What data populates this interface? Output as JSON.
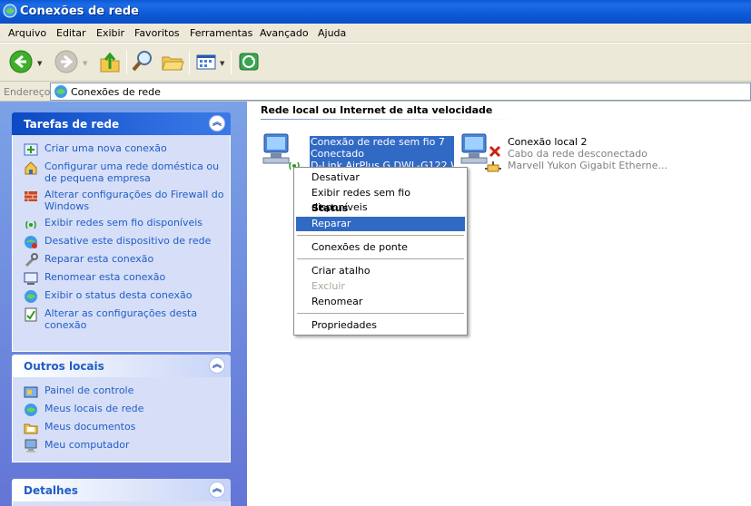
{
  "window": {
    "title": "Conexões de rede"
  },
  "menu": [
    "Arquivo",
    "Editar",
    "Exibir",
    "Favoritos",
    "Ferramentas",
    "Avançado",
    "Ajuda"
  ],
  "address": {
    "label": "Endereço",
    "value": "Conexões de rede"
  },
  "left": {
    "panels": [
      {
        "title": "Tarefas de rede",
        "items": [
          {
            "label": "Criar uma nova conexão",
            "icon": "new-connection-icon"
          },
          {
            "label": "Configurar uma rede doméstica ou de pequena empresa",
            "icon": "home-network-icon"
          },
          {
            "label": "Alterar configurações do Firewall do Windows",
            "icon": "firewall-icon"
          },
          {
            "label": "Exibir redes sem fio disponíveis",
            "icon": "wireless-icon"
          },
          {
            "label": "Desative este dispositivo de rede",
            "icon": "disable-device-icon"
          },
          {
            "label": "Reparar esta conexão",
            "icon": "repair-icon"
          },
          {
            "label": "Renomear esta conexão",
            "icon": "rename-icon"
          },
          {
            "label": "Exibir o status desta conexão",
            "icon": "status-icon"
          },
          {
            "label": "Alterar as configurações desta conexão",
            "icon": "settings-icon"
          }
        ]
      },
      {
        "title": "Outros locais",
        "items": [
          {
            "label": "Painel de controle",
            "icon": "control-panel-icon"
          },
          {
            "label": "Meus locais de rede",
            "icon": "network-places-icon"
          },
          {
            "label": "Meus documentos",
            "icon": "documents-icon"
          },
          {
            "label": "Meu computador",
            "icon": "computer-icon"
          }
        ]
      },
      {
        "title": "Detalhes",
        "items": []
      }
    ]
  },
  "main": {
    "group_title": "Rede local ou Internet de alta velocidade",
    "connections": [
      {
        "name": "Conexão de rede sem fio 7",
        "status": "Conectado",
        "device": "D-Link AirPlus G DWL-G122 Wi..."
      },
      {
        "name": "Conexão local 2",
        "status": "Cabo da rede desconectado",
        "device": "Marvell Yukon Gigabit Etherne..."
      }
    ]
  },
  "context_menu": {
    "items": [
      "Desativar",
      "Exibir redes sem fio disponíveis",
      "Status",
      "Reparar",
      "Conexões de ponte",
      "Criar atalho",
      "Excluir",
      "Renomear",
      "Propriedades"
    ]
  },
  "colors": {
    "titlebar": "#0a5ad6",
    "selection": "#316ac5",
    "link": "#215dc6",
    "left_pane": "#7ba2e7"
  }
}
